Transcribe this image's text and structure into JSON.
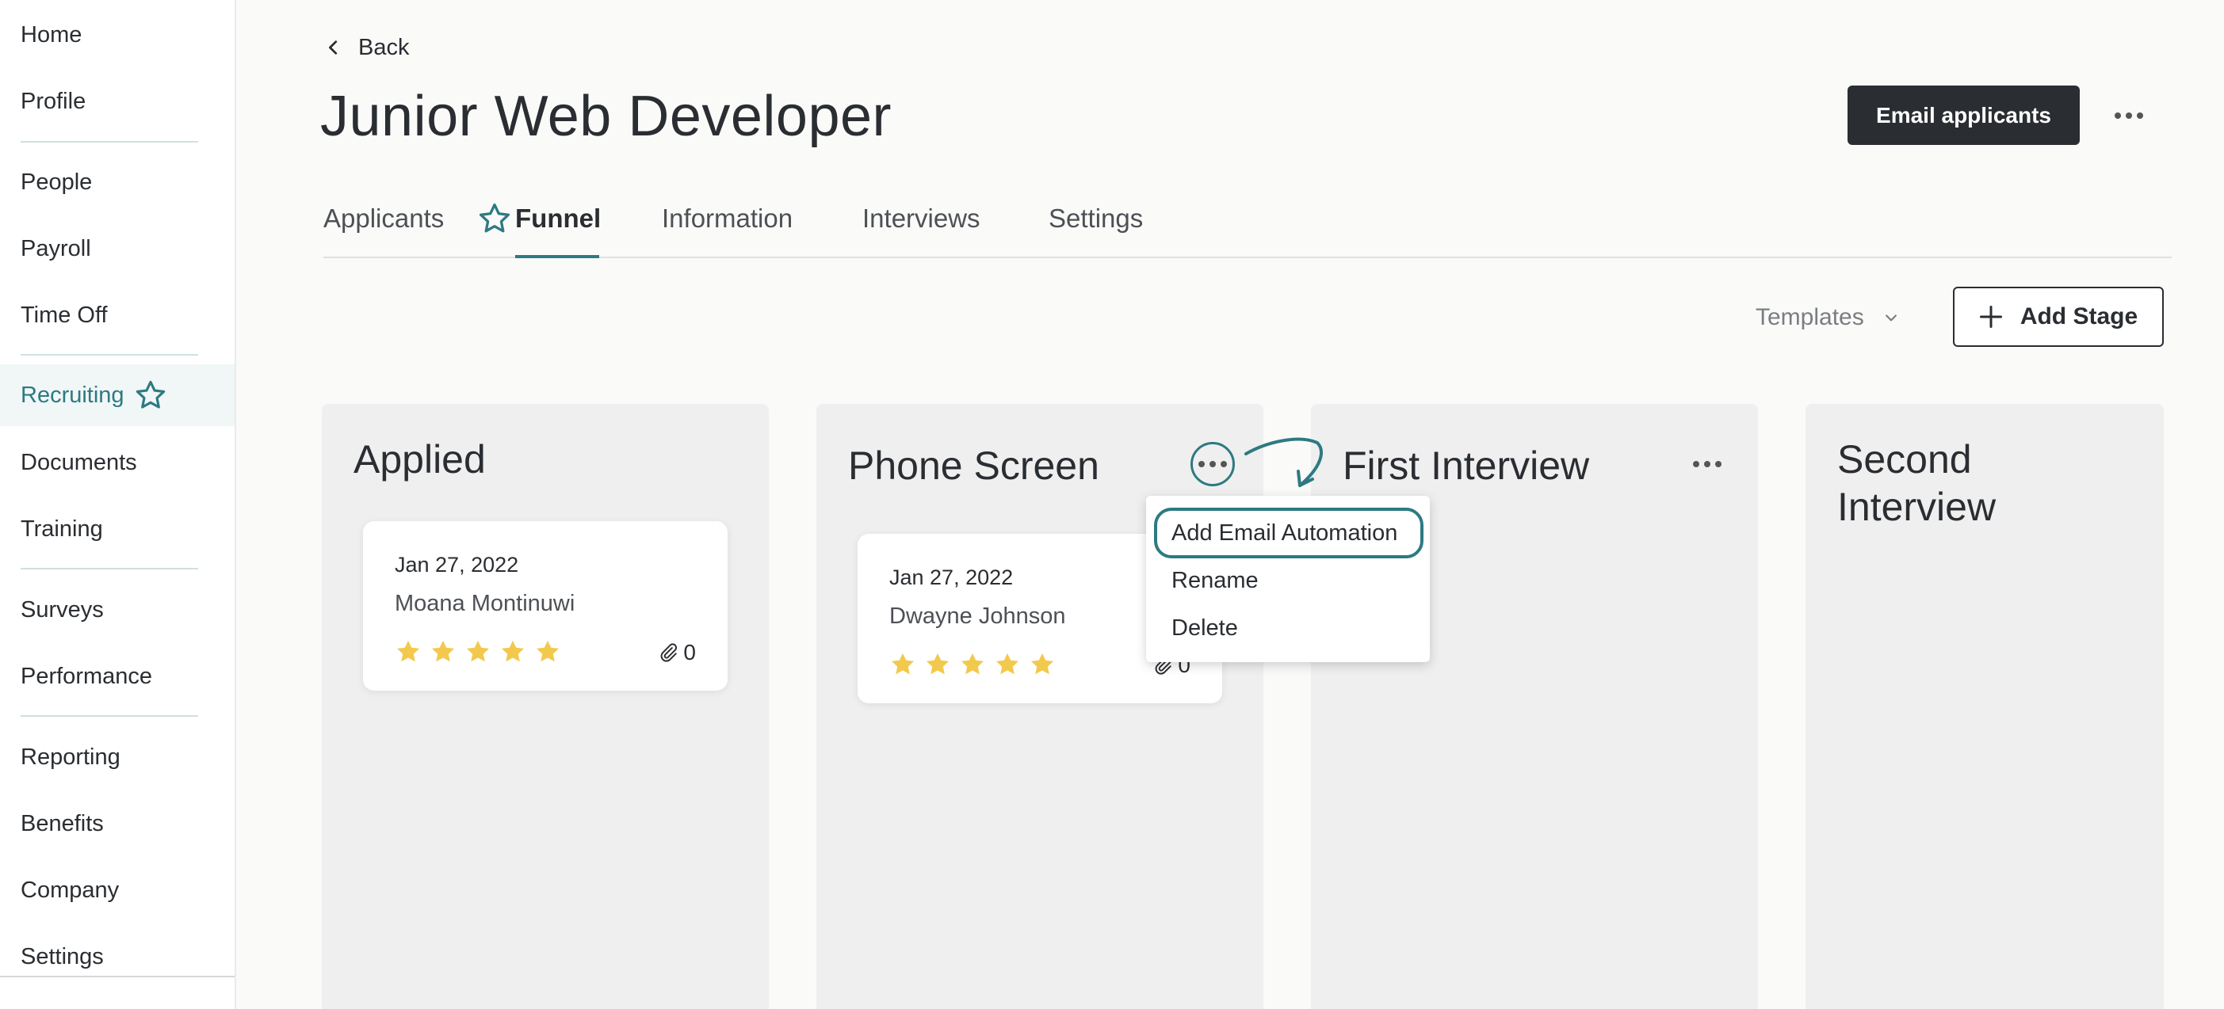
{
  "sidebar": {
    "items": [
      {
        "label": "Home"
      },
      {
        "label": "Profile"
      },
      {
        "label": "People"
      },
      {
        "label": "Payroll"
      },
      {
        "label": "Time Off"
      },
      {
        "label": "Recruiting"
      },
      {
        "label": "Documents"
      },
      {
        "label": "Training"
      },
      {
        "label": "Surveys"
      },
      {
        "label": "Performance"
      },
      {
        "label": "Reporting"
      },
      {
        "label": "Benefits"
      },
      {
        "label": "Company"
      },
      {
        "label": "Settings"
      }
    ],
    "active": "Recruiting"
  },
  "header": {
    "back_label": "Back",
    "title": "Junior Web Developer",
    "email_button": "Email applicants"
  },
  "tabs": [
    {
      "label": "Applicants"
    },
    {
      "label": "Funnel"
    },
    {
      "label": "Information"
    },
    {
      "label": "Interviews"
    },
    {
      "label": "Settings"
    }
  ],
  "active_tab": "Funnel",
  "toolbar": {
    "templates_label": "Templates",
    "add_stage_label": "Add Stage"
  },
  "columns": [
    {
      "title": "Applied",
      "cards": [
        {
          "date": "Jan 27, 2022",
          "name": "Moana Montinuwi",
          "rating": 5,
          "attachments": "0"
        }
      ]
    },
    {
      "title": "Phone Screen",
      "cards": [
        {
          "date": "Jan 27, 2022",
          "name": "Dwayne Johnson",
          "rating": 5,
          "attachments": "0"
        }
      ]
    },
    {
      "title": "First Interview",
      "cards": []
    },
    {
      "title": "Second\nInterview",
      "cards": []
    }
  ],
  "stage_menu": {
    "items": [
      {
        "label": "Add Email Automation"
      },
      {
        "label": "Rename"
      },
      {
        "label": "Delete"
      }
    ],
    "highlighted": "Add Email Automation"
  },
  "colors": {
    "accent": "#2d7a82",
    "star": "#f2c94c",
    "dark_button": "#2a2d31",
    "column_bg": "#efefef"
  }
}
